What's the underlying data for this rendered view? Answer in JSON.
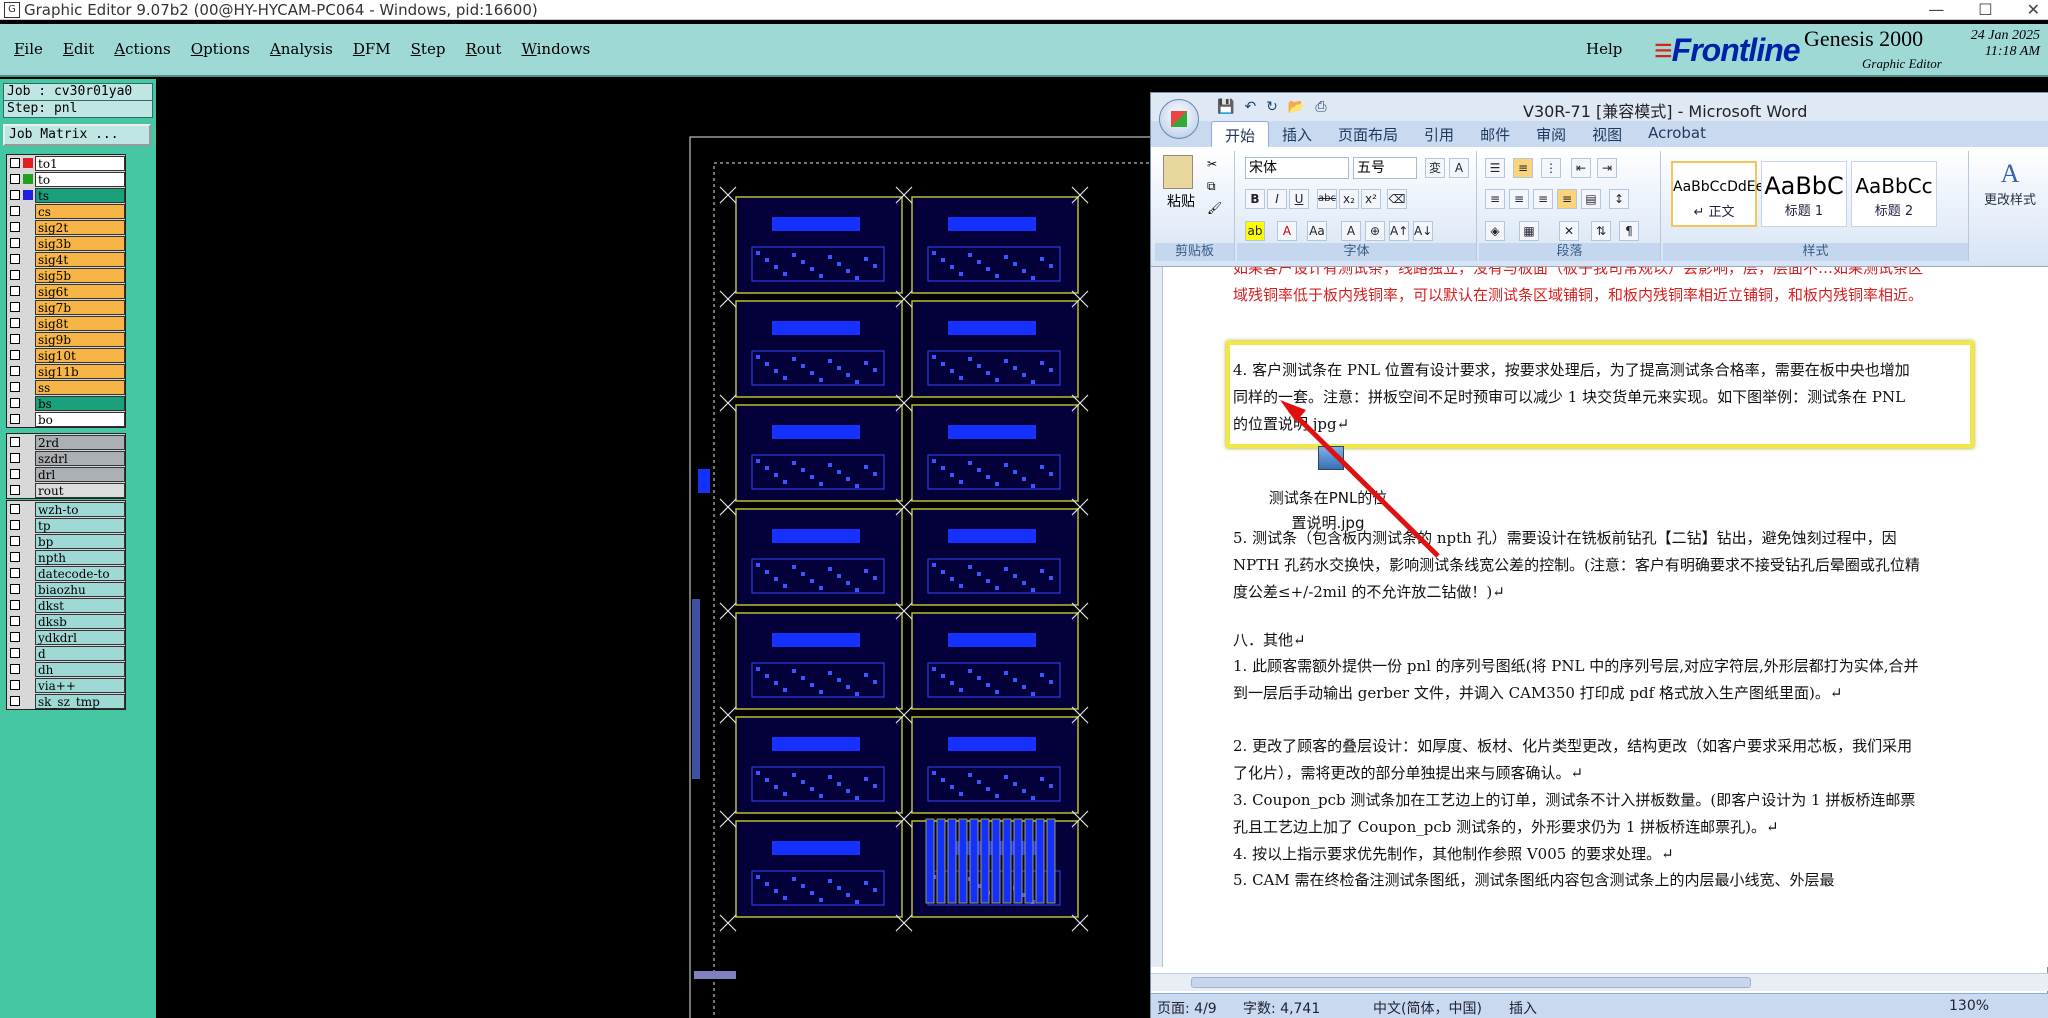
{
  "genesis": {
    "title": "Graphic Editor 9.07b2 (00@HY-HYCAM-PC064 - Windows, pid:16600)",
    "menus": [
      "File",
      "Edit",
      "Actions",
      "Options",
      "Analysis",
      "DFM",
      "Step",
      "Rout",
      "Windows"
    ],
    "help": "Help",
    "logo": "Frontline",
    "product": "Genesis 2000",
    "subtitle": "Graphic Editor",
    "date": "24 Jan 2025",
    "time": "11:18 AM",
    "job": "Job : cv30r01ya0",
    "step": "Step: pnl",
    "job_matrix": "Job Matrix ...",
    "layers_top": [
      {
        "name": "to1",
        "swatch": "#e02020",
        "bg": "#ffffff"
      },
      {
        "name": "to",
        "swatch": "#20a020",
        "bg": "#ffffff"
      },
      {
        "name": "ts",
        "swatch": "#2020e0",
        "bg": "#1aa17c"
      },
      {
        "name": "cs",
        "swatch": "",
        "bg": "#f7b548"
      },
      {
        "name": "sig2t",
        "swatch": "",
        "bg": "#f7b548"
      },
      {
        "name": "sig3b",
        "swatch": "",
        "bg": "#f7b548"
      },
      {
        "name": "sig4t",
        "swatch": "",
        "bg": "#f7b548"
      },
      {
        "name": "sig5b",
        "swatch": "",
        "bg": "#f7b548"
      },
      {
        "name": "sig6t",
        "swatch": "",
        "bg": "#f7b548"
      },
      {
        "name": "sig7b",
        "swatch": "",
        "bg": "#f7b548"
      },
      {
        "name": "sig8t",
        "swatch": "",
        "bg": "#f7b548"
      },
      {
        "name": "sig9b",
        "swatch": "",
        "bg": "#f7b548"
      },
      {
        "name": "sig10t",
        "swatch": "",
        "bg": "#f7b548"
      },
      {
        "name": "sig11b",
        "swatch": "",
        "bg": "#f7b548"
      },
      {
        "name": "ss",
        "swatch": "",
        "bg": "#f7b548"
      },
      {
        "name": "bs",
        "swatch": "",
        "bg": "#1aa17c"
      },
      {
        "name": "bo",
        "swatch": "",
        "bg": "#ffffff"
      }
    ],
    "layers_drill": [
      {
        "name": "2rd",
        "bg": "#aab0b4"
      },
      {
        "name": "szdrl",
        "bg": "#aab0b4"
      },
      {
        "name": "drl",
        "bg": "#aab0b4"
      },
      {
        "name": "rout",
        "bg": "#dcdcdc"
      }
    ],
    "layers_misc": [
      "wzh-to",
      "tp",
      "bp",
      "npth",
      "datecode-to",
      "biaozhu",
      "dkst",
      "dksb",
      "ydkdrl",
      "d",
      "dh",
      "via++",
      "sk_sz_tmp"
    ]
  },
  "word": {
    "title": "V30R-71 [兼容模式] - Microsoft Word",
    "tabs": [
      "开始",
      "插入",
      "页面布局",
      "引用",
      "邮件",
      "审阅",
      "视图",
      "Acrobat"
    ],
    "font_name": "宋体",
    "font_size": "五号",
    "groups": [
      "剪贴板",
      "字体",
      "段落",
      "样式"
    ],
    "paste_label": "粘贴",
    "change_styles": "更改样式",
    "styles": [
      {
        "preview": "AaBbCcDdEe",
        "caption": "↵ 正文"
      },
      {
        "preview": "AaBbC",
        "caption": "标题 1"
      },
      {
        "preview": "AaBbCc",
        "caption": "标题 2"
      }
    ],
    "paragraphs": {
      "red_top": "如果客户设计有测试条，线路独立，没有与板面（板子我司常规以）会影响，层，层面不…如果测试条区域残铜率低于板内残铜率，可以默认在测试条区域铺铜，和板内残铜率相近立铺铜，和板内残铜率相近。",
      "p4": "4. 客户测试条在 PNL 位置有设计要求，按要求处理后，为了提高测试条合格率，需要在板中央也增加同样的一套。注意：拼板空间不足时预审可以减少 1 块交货单元来实现。如下图举例：测试条在 PNL 的位置说明.jpg↵",
      "img_caption": "测试条在PNL的位置说明.jpg",
      "p5": "5. 测试条（包含板内测试条的 npth 孔）需要设计在铣板前钻孔【二钻】钻出，避免蚀刻过程中，因 NPTH 孔药水交换快，影响测试条线宽公差的控制。(注意：客户有明确要求不接受钻孔后晕圈或孔位精度公差≤+/-2mil 的不允许放二钻做！)↵",
      "sec8": "八．其他↵",
      "o1": "1. 此顾客需额外提供一份 pnl 的序列号图纸(将 PNL 中的序列号层,对应字符层,外形层都打为实体,合并到一层后手动输出 gerber 文件，并调入 CAM350 打印成 pdf 格式放入生产图纸里面)。↵",
      "o2": "2. 更改了顾客的叠层设计：如厚度、板材、化片类型更改，结构更改（如客户要求采用芯板，我们采用了化片），需将更改的部分单独提出来与顾客确认。↵",
      "o3": "3. Coupon_pcb 测试条加在工艺边上的订单，测试条不计入拼板数量。(即客户设计为 1 拼板桥连邮票孔且工艺边上加了 Coupon_pcb 测试条的，外形要求仍为 1 拼板桥连邮票孔)。↵",
      "o4": "4. 按以上指示要求优先制作，其他制作参照 V005 的要求处理。↵",
      "o5": "5. CAM 需在终检备注测试条图纸，测试条图纸内容包含测试条上的内层最小线宽、外层最"
    },
    "status": {
      "page": "页面: 4/9",
      "words": "字数: 4,741",
      "lang": "中文(简体，中国)",
      "mode": "插入",
      "zoom": "130%"
    },
    "highlight_color": "#f0e84a",
    "arrow_color": "#e01010"
  }
}
